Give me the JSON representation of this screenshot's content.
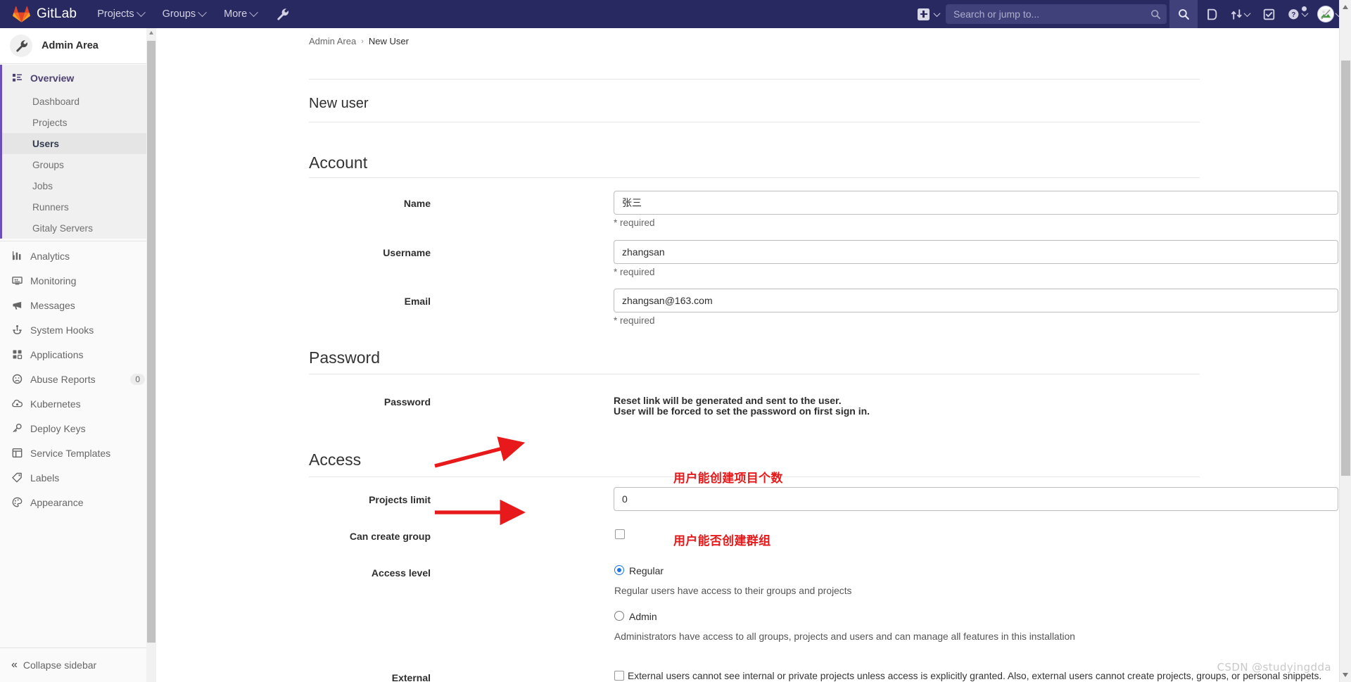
{
  "navbar": {
    "brand": "GitLab",
    "items": [
      {
        "label": "Projects",
        "caret": true
      },
      {
        "label": "Groups",
        "caret": true
      },
      {
        "label": "More",
        "caret": true
      }
    ],
    "admin_wrench_icon": "wrench-icon",
    "new_icon": "plus-square-icon",
    "search": {
      "placeholder": "Search or jump to...",
      "value": ""
    },
    "right_icons": [
      "search-icon",
      "issues-icon",
      "merge-requests-icon",
      "todos-icon",
      "help-icon",
      "user-avatar-icon"
    ]
  },
  "sidebar": {
    "title": "Admin Area",
    "header_icon": "wrench-icon",
    "overview": {
      "label": "Overview",
      "icon": "overview-icon"
    },
    "sub_items": [
      {
        "label": "Dashboard",
        "active": false
      },
      {
        "label": "Projects",
        "active": false
      },
      {
        "label": "Users",
        "active": true
      },
      {
        "label": "Groups",
        "active": false
      },
      {
        "label": "Jobs",
        "active": false
      },
      {
        "label": "Runners",
        "active": false
      },
      {
        "label": "Gitaly Servers",
        "active": false
      }
    ],
    "items": [
      {
        "label": "Analytics",
        "icon": "chart-icon",
        "badge": ""
      },
      {
        "label": "Monitoring",
        "icon": "monitor-icon",
        "badge": ""
      },
      {
        "label": "Messages",
        "icon": "megaphone-icon",
        "badge": ""
      },
      {
        "label": "System Hooks",
        "icon": "hook-icon",
        "badge": ""
      },
      {
        "label": "Applications",
        "icon": "grid-icon",
        "badge": ""
      },
      {
        "label": "Abuse Reports",
        "icon": "sad-face-icon",
        "badge": "0"
      },
      {
        "label": "Kubernetes",
        "icon": "kubernetes-icon",
        "badge": ""
      },
      {
        "label": "Deploy Keys",
        "icon": "key-icon",
        "badge": ""
      },
      {
        "label": "Service Templates",
        "icon": "template-icon",
        "badge": ""
      },
      {
        "label": "Labels",
        "icon": "label-icon",
        "badge": ""
      },
      {
        "label": "Appearance",
        "icon": "palette-icon",
        "badge": ""
      }
    ],
    "collapse": "Collapse sidebar"
  },
  "breadcrumb": {
    "root": "Admin Area",
    "separator": "›",
    "current": "New User"
  },
  "page": {
    "title": "New user"
  },
  "sections": {
    "account": {
      "heading": "Account",
      "name": {
        "label": "Name",
        "value": "张三",
        "hint": "* required"
      },
      "username": {
        "label": "Username",
        "value": "zhangsan",
        "hint": "* required"
      },
      "email": {
        "label": "Email",
        "value": "zhangsan@163.com",
        "hint": "* required"
      }
    },
    "password": {
      "heading": "Password",
      "label": "Password",
      "line1": "Reset link will be generated and sent to the user.",
      "line2": "User will be forced to set the password on first sign in."
    },
    "access": {
      "heading": "Access",
      "projects_limit": {
        "label": "Projects limit",
        "value": "0"
      },
      "can_create_group": {
        "label": "Can create group",
        "checked": false
      },
      "access_level": {
        "label": "Access level",
        "options": [
          {
            "label": "Regular",
            "selected": true,
            "description": "Regular users have access to their groups and projects"
          },
          {
            "label": "Admin",
            "selected": false,
            "description": "Administrators have access to all groups, projects and users and can manage all features in this installation"
          }
        ]
      },
      "external": {
        "label": "External",
        "checked": false,
        "description": "External users cannot see internal or private projects unless access is explicitly granted. Also, external users cannot create projects, groups, or personal snippets."
      }
    }
  },
  "annotations": {
    "color": "#e8191b",
    "projects_limit_note": "用户能创建项目个数",
    "can_create_group_note": "用户能否创建群组"
  },
  "watermark": "CSDN @studyingdda"
}
